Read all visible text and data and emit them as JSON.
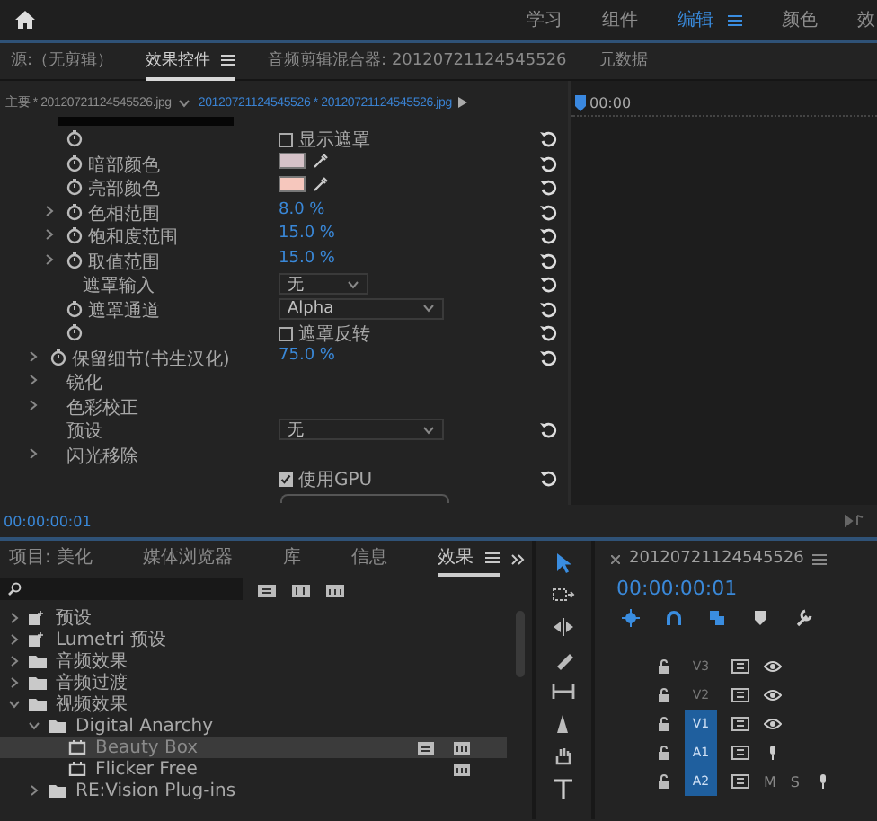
{
  "workspaces": [
    {
      "label": "学习",
      "selected": false
    },
    {
      "label": "组件",
      "selected": false
    },
    {
      "label": "编辑",
      "selected": true
    },
    {
      "label": "颜色",
      "selected": false
    },
    {
      "label": "效",
      "selected": false
    }
  ],
  "panel_tabs": [
    {
      "label": "源:（无剪辑）",
      "selected": false
    },
    {
      "label": "效果控件",
      "selected": true
    },
    {
      "label": "音频剪辑混合器: 20120721124545526",
      "selected": false
    },
    {
      "label": "元数据",
      "selected": false
    }
  ],
  "effect_controls": {
    "master_clip": "主要 * 20120721124545526.jpg",
    "sequence_clip": "20120721124545526 * 20120721124545526.jpg",
    "ruler_time": "00:00",
    "properties": [
      {
        "kind": "checkbox",
        "indented": true,
        "arrow": false,
        "stopwatch": true,
        "value": "显示遮罩",
        "checked": false,
        "reset": true
      },
      {
        "kind": "color",
        "indented": true,
        "arrow": false,
        "stopwatch": true,
        "label": "暗部颜色",
        "color": "#d6c2c8",
        "reset": true
      },
      {
        "kind": "color",
        "indented": true,
        "arrow": false,
        "stopwatch": true,
        "label": "亮部颜色",
        "color": "#f6c7bd",
        "reset": true
      },
      {
        "kind": "number",
        "indented": true,
        "arrow": true,
        "stopwatch": true,
        "label": "色相范围",
        "value": "8.0 %",
        "reset": true
      },
      {
        "kind": "number",
        "indented": true,
        "arrow": true,
        "stopwatch": true,
        "label": "饱和度范围",
        "value": "15.0 %",
        "reset": true
      },
      {
        "kind": "number",
        "indented": true,
        "arrow": true,
        "stopwatch": true,
        "label": "取值范围",
        "value": "15.0 %",
        "reset": true
      },
      {
        "kind": "dropdown",
        "indented": true,
        "arrow": false,
        "stopwatch": false,
        "label": "遮罩输入",
        "value": "无",
        "wide": false,
        "reset": true
      },
      {
        "kind": "dropdown",
        "indented": true,
        "arrow": false,
        "stopwatch": true,
        "label": "遮罩通道",
        "value": "Alpha",
        "wide": true,
        "reset": true
      },
      {
        "kind": "checkbox",
        "indented": true,
        "arrow": false,
        "stopwatch": true,
        "value": "遮罩反转",
        "checked": false,
        "reset": true
      },
      {
        "kind": "number",
        "indented": false,
        "arrow": true,
        "stopwatch": true,
        "label": "保留细节(书生汉化)",
        "value": "75.0 %",
        "reset": true
      },
      {
        "kind": "group",
        "indented": false,
        "arrow": true,
        "stopwatch": false,
        "label": "锐化",
        "reset": false
      },
      {
        "kind": "group",
        "indented": false,
        "arrow": true,
        "stopwatch": false,
        "label": "色彩校正",
        "reset": false
      },
      {
        "kind": "dropdown",
        "indented": false,
        "arrow": false,
        "stopwatch": false,
        "label": "预设",
        "value": "无",
        "wide": true,
        "reset": true
      },
      {
        "kind": "group",
        "indented": false,
        "arrow": true,
        "stopwatch": false,
        "label": "闪光移除",
        "reset": false
      },
      {
        "kind": "checkbox",
        "indented": false,
        "arrow": false,
        "stopwatch": false,
        "value": "使用GPU",
        "checked": true,
        "reset": true
      }
    ],
    "timecode": "00:00:00:01"
  },
  "effects_panel": {
    "tabs": [
      {
        "label": "项目: 美化",
        "selected": false
      },
      {
        "label": "媒体浏览器",
        "selected": false
      },
      {
        "label": "库",
        "selected": false
      },
      {
        "label": "信息",
        "selected": false
      },
      {
        "label": "效果",
        "selected": true
      }
    ],
    "tree": [
      {
        "label": "预设",
        "kind": "preset",
        "expanded": false
      },
      {
        "label": "Lumetri 预设",
        "kind": "preset",
        "expanded": false
      },
      {
        "label": "音频效果",
        "kind": "folder",
        "expanded": false
      },
      {
        "label": "音频过渡",
        "kind": "folder",
        "expanded": false
      },
      {
        "label": "视频效果",
        "kind": "folder",
        "expanded": true,
        "children": [
          {
            "label": "Digital Anarchy",
            "kind": "folder",
            "expanded": true,
            "children": [
              {
                "label": "Beauty Box",
                "kind": "effect",
                "selected": true,
                "accelerated": true,
                "yuv": true
              },
              {
                "label": "Flicker Free",
                "kind": "effect",
                "selected": false,
                "accelerated": false,
                "yuv": true
              }
            ]
          },
          {
            "label": "RE:Vision Plug-ins",
            "kind": "folder",
            "expanded": false
          }
        ]
      }
    ]
  },
  "timeline": {
    "sequence": "20120721124545526",
    "timecode": "00:00:00:01",
    "tracks": [
      {
        "name": "V3",
        "kind": "video",
        "targeted": false
      },
      {
        "name": "V2",
        "kind": "video",
        "targeted": false
      },
      {
        "name": "V1",
        "kind": "video",
        "targeted": true
      },
      {
        "name": "A1",
        "kind": "audio",
        "targeted": true
      },
      {
        "name": "A2",
        "kind": "audio",
        "targeted": true,
        "mute": "M",
        "solo": "S"
      }
    ]
  }
}
